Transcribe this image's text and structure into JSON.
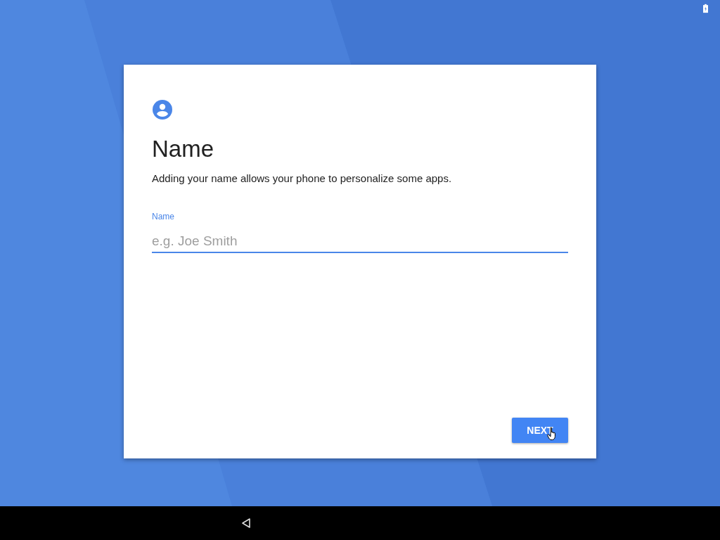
{
  "card": {
    "title": "Name",
    "description": "Adding your name allows your phone to personalize some apps.",
    "field": {
      "label": "Name",
      "placeholder": "e.g. Joe Smith",
      "focused": true
    },
    "next_button": {
      "label": "NEXT"
    }
  }
}
